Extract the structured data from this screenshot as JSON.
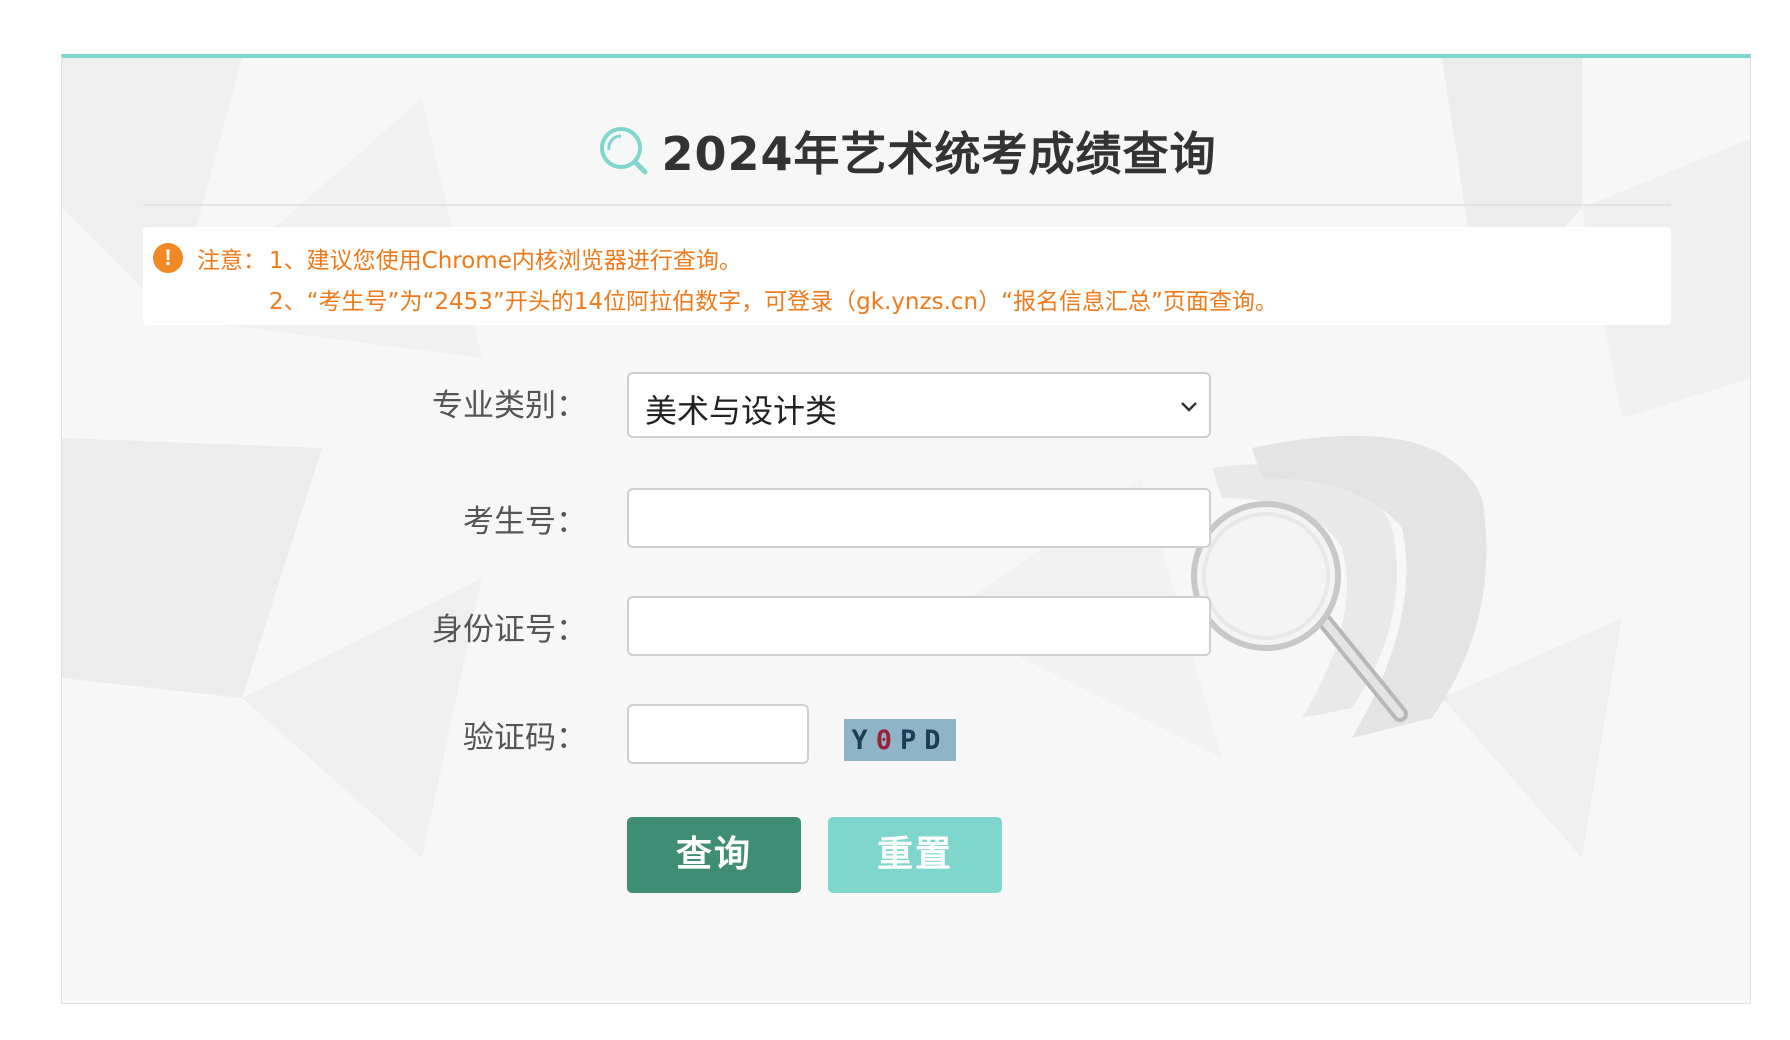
{
  "page": {
    "title": "2024年艺术统考成绩查询",
    "accent_color": "#7fd6cd",
    "primary_button_color": "#3f8d74",
    "notice_color": "#f07a1a"
  },
  "notice": {
    "label": "注意：",
    "line1": "1、建议您使用Chrome内核浏览器进行查询。",
    "line2": "2、“考生号”为“2453”开头的14位阿拉伯数字，可登录（gk.ynzs.cn）“报名信息汇总”页面查询。",
    "icon": "exclamation-icon"
  },
  "form": {
    "category_label": "专业类别：",
    "category_value": "美术与设计类",
    "exam_number_label": "考生号：",
    "exam_number_value": "",
    "id_number_label": "身份证号：",
    "id_number_value": "",
    "captcha_label": "验证码：",
    "captcha_value": "",
    "captcha_image": {
      "c1": "Y",
      "c2": "0",
      "c3": "P",
      "c4": "D"
    }
  },
  "buttons": {
    "query": "查询",
    "reset": "重置"
  },
  "icons": {
    "title_icon": "search-icon",
    "decoration": "magnifier-illustration",
    "select_arrow": "chevron-down-icon"
  }
}
